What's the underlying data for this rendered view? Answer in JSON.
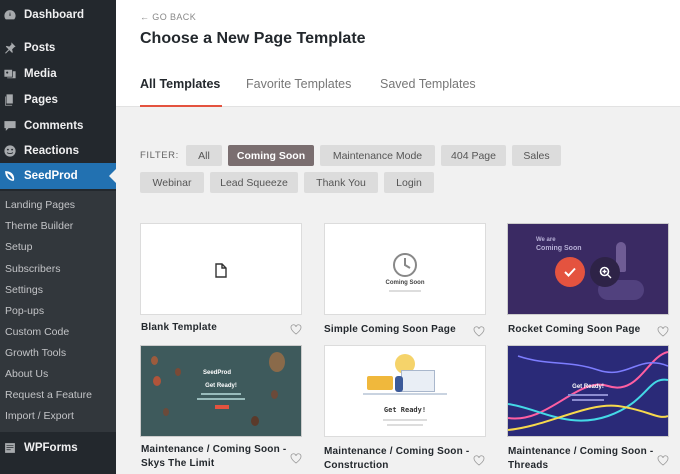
{
  "sidebar": {
    "top_items": [
      {
        "label": "Dashboard",
        "icon": "dashboard-icon"
      },
      {
        "label": "Posts",
        "icon": "pin-icon"
      },
      {
        "label": "Media",
        "icon": "media-icon"
      },
      {
        "label": "Pages",
        "icon": "pages-icon"
      },
      {
        "label": "Comments",
        "icon": "comment-icon"
      },
      {
        "label": "Reactions",
        "icon": "reaction-icon"
      },
      {
        "label": "SeedProd",
        "icon": "seedprod-icon"
      }
    ],
    "sub_items": [
      {
        "label": "Landing Pages"
      },
      {
        "label": "Theme Builder"
      },
      {
        "label": "Setup"
      },
      {
        "label": "Subscribers"
      },
      {
        "label": "Settings"
      },
      {
        "label": "Pop-ups"
      },
      {
        "label": "Custom Code"
      },
      {
        "label": "Growth Tools"
      },
      {
        "label": "About Us"
      },
      {
        "label": "Request a Feature"
      },
      {
        "label": "Import / Export"
      }
    ],
    "wpforms": "WPForms"
  },
  "header": {
    "go_back": "← GO BACK",
    "title": "Choose a New Page Template",
    "tabs": [
      {
        "label": "All Templates"
      },
      {
        "label": "Favorite Templates"
      },
      {
        "label": "Saved Templates"
      }
    ]
  },
  "filter": {
    "label": "FILTER:",
    "chips": [
      {
        "label": "All"
      },
      {
        "label": "Coming Soon"
      },
      {
        "label": "Maintenance Mode"
      },
      {
        "label": "404 Page"
      },
      {
        "label": "Sales"
      },
      {
        "label": "Webinar"
      },
      {
        "label": "Lead Squeeze"
      },
      {
        "label": "Thank You"
      },
      {
        "label": "Login"
      }
    ]
  },
  "cards": [
    {
      "title": "Blank Template"
    },
    {
      "title": "Simple Coming Soon Page",
      "thumb_text": "Coming Soon"
    },
    {
      "title": "Rocket Coming Soon Page",
      "thumb_text_1": "We are",
      "thumb_text_2": "Coming Soon"
    },
    {
      "title_line1": "Maintenance / Coming Soon -",
      "title_line2": "Skys The Limit",
      "thumb_brand": "SeedProd",
      "thumb_text": "Get Ready!"
    },
    {
      "title_line1": "Maintenance / Coming Soon -",
      "title_line2": "Construction",
      "thumb_text": "Get Ready!"
    },
    {
      "title_line1": "Maintenance / Coming Soon -",
      "title_line2": "Threads",
      "thumb_text": "Get Ready!"
    }
  ],
  "colors": {
    "accent": "#e4533f",
    "sidebar_bg": "#23282d",
    "active_menu": "#2271b1",
    "active_chip": "#7a6e70"
  }
}
